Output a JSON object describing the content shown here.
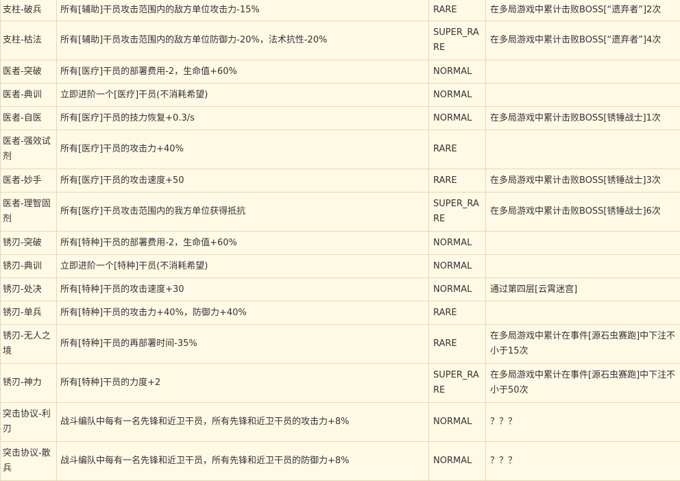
{
  "table": {
    "rows": [
      {
        "name": "支柱-破兵",
        "effect": "所有[辅助]干员攻击范围内的敌方单位攻击力-15%",
        "rarity": "RARE",
        "unlock": "在多局游戏中累计击败BOSS[“遗弃者”]2次"
      },
      {
        "name": "支柱-枯法",
        "effect": "所有[辅助]干员攻击范围内的敌方单位防御力-20%，法术抗性-20%",
        "rarity": "SUPER_RARE",
        "unlock": "在多局游戏中累计击败BOSS[“遗弃者”]4次"
      },
      {
        "name": "医者-突破",
        "effect": "所有[医疗]干员的部署费用-2，生命值+60%",
        "rarity": "NORMAL",
        "unlock": ""
      },
      {
        "name": "医者-典训",
        "effect": "立即进阶一个[医疗]干员(不消耗希望)",
        "rarity": "NORMAL",
        "unlock": ""
      },
      {
        "name": "医者-自医",
        "effect": "所有[医疗]干员的技力恢复+0.3/s",
        "rarity": "NORMAL",
        "unlock": "在多局游戏中累计击败BOSS[锈锤战士]1次"
      },
      {
        "name": "医者-强效试剂",
        "effect": "所有[医疗]干员的攻击力+40%",
        "rarity": "RARE",
        "unlock": ""
      },
      {
        "name": "医者-妙手",
        "effect": "所有[医疗]干员的攻击速度+50",
        "rarity": "RARE",
        "unlock": "在多局游戏中累计击败BOSS[锈锤战士]3次"
      },
      {
        "name": "医者-理智固剂",
        "effect": "所有[医疗]干员攻击范围内的我方单位获得抵抗",
        "rarity": "SUPER_RARE",
        "unlock": "在多局游戏中累计击败BOSS[锈锤战士]6次"
      },
      {
        "name": "锈刃-突破",
        "effect": "所有[特种]干员的部署费用-2，生命值+60%",
        "rarity": "NORMAL",
        "unlock": ""
      },
      {
        "name": "锈刃-典训",
        "effect": "立即进阶一个[特种]干员(不消耗希望)",
        "rarity": "NORMAL",
        "unlock": ""
      },
      {
        "name": "锈刃-处决",
        "effect": "所有[特种]干员的攻击速度+30",
        "rarity": "NORMAL",
        "unlock": "通过第四层[云霄迷宫]"
      },
      {
        "name": "锈刃-单兵",
        "effect": "所有[特种]干员的攻击力+40%，防御力+40%",
        "rarity": "RARE",
        "unlock": ""
      },
      {
        "name": "锈刃-无人之境",
        "effect": "所有[特种]干员的再部署时间-35%",
        "rarity": "RARE",
        "unlock": "在多局游戏中累计在事件[源石虫赛跑]中下注不小于15次"
      },
      {
        "name": "锈刃-神力",
        "effect": "所有[特种]干员的力度+2",
        "rarity": "SUPER_RARE",
        "unlock": "在多局游戏中累计在事件[源石虫赛跑]中下注不小于50次"
      },
      {
        "name": "突击协议-利刃",
        "effect": "战斗编队中每有一名先锋和近卫干员，所有先锋和近卫干员的攻击力+8%",
        "rarity": "NORMAL",
        "unlock": "？？？"
      },
      {
        "name": "突击协议-散兵",
        "effect": "战斗编队中每有一名先锋和近卫干员，所有先锋和近卫干员的防御力+8%",
        "rarity": "NORMAL",
        "unlock": "？？？"
      }
    ]
  }
}
